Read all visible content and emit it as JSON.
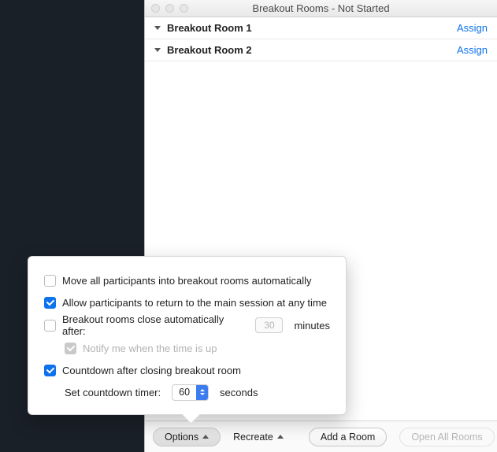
{
  "window": {
    "title": "Breakout Rooms - Not Started"
  },
  "rooms": [
    {
      "name": "Breakout Room 1",
      "action": "Assign"
    },
    {
      "name": "Breakout Room 2",
      "action": "Assign"
    }
  ],
  "footer": {
    "options_label": "Options",
    "recreate_label": "Recreate",
    "add_room_label": "Add a Room",
    "open_all_label": "Open All Rooms"
  },
  "options": {
    "move_auto": {
      "checked": false,
      "label": "Move all participants into breakout rooms automatically"
    },
    "allow_return": {
      "checked": true,
      "label": "Allow participants to return to the main session at any time"
    },
    "auto_close": {
      "checked": false,
      "label": "Breakout rooms close automatically after:",
      "value": "30",
      "unit": "minutes"
    },
    "notify": {
      "checked": true,
      "disabled": true,
      "label": "Notify me when the time is up"
    },
    "countdown": {
      "checked": true,
      "label": "Countdown after closing breakout room"
    },
    "countdown_timer": {
      "label_prefix": "Set countdown timer:",
      "value": "60",
      "unit": "seconds"
    }
  }
}
